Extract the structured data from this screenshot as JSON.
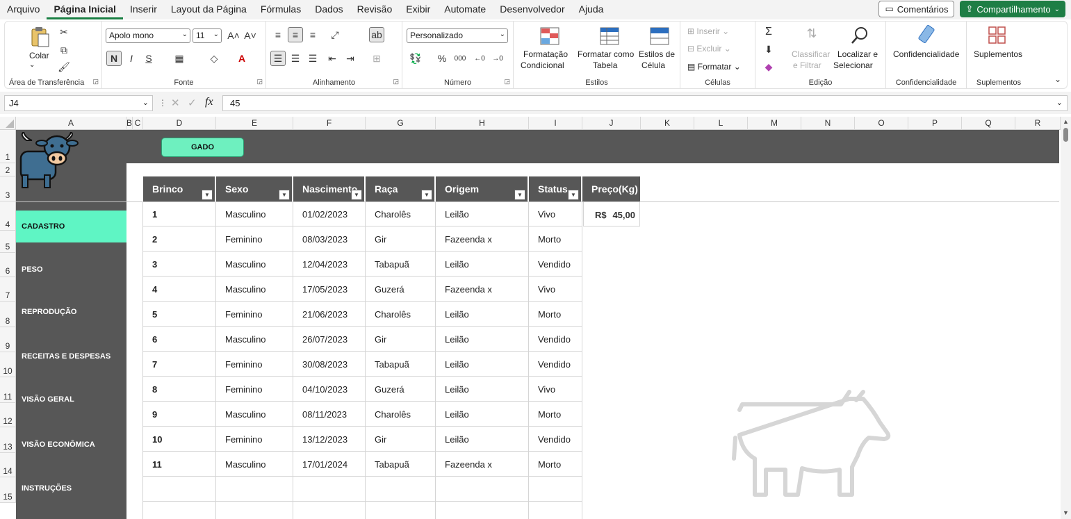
{
  "menu": {
    "tabs": [
      "Arquivo",
      "Página Inicial",
      "Inserir",
      "Layout da Página",
      "Fórmulas",
      "Dados",
      "Revisão",
      "Exibir",
      "Automate",
      "Desenvolvedor",
      "Ajuda"
    ],
    "comments_label": "Comentários",
    "share_label": "Compartilhamento"
  },
  "ribbon": {
    "clipboard": {
      "paste": "Colar",
      "label": "Área de Transferência"
    },
    "font": {
      "name": "Apolo mono",
      "size": "11",
      "bold": "N",
      "italic": "I",
      "underline": "S",
      "label": "Fonte"
    },
    "alignment": {
      "label": "Alinhamento"
    },
    "number": {
      "format": "Personalizado",
      "label": "Número"
    },
    "styles": {
      "cond_line1": "Formatação",
      "cond_line2": "Condicional",
      "table_line1": "Formatar como",
      "table_line2": "Tabela",
      "cell_line1": "Estilos de",
      "cell_line2": "Célula",
      "label": "Estilos"
    },
    "cells": {
      "insert": "Inserir",
      "delete": "Excluir",
      "format": "Formatar",
      "label": "Células"
    },
    "editing": {
      "sort_line1": "Classificar",
      "sort_line2": "e Filtrar",
      "find_line1": "Localizar e",
      "find_line2": "Selecionar",
      "label": "Edição"
    },
    "sensitivity": {
      "button": "Confidencialidade",
      "label": "Confidencialidade"
    },
    "addins": {
      "button": "Suplementos",
      "label": "Suplementos"
    }
  },
  "formula_bar": {
    "cell_ref": "J4",
    "value": "45"
  },
  "columns": [
    "A",
    "B",
    "C",
    "D",
    "E",
    "F",
    "G",
    "H",
    "I",
    "J",
    "K",
    "L",
    "M",
    "N",
    "O",
    "P",
    "Q",
    "R"
  ],
  "rows": [
    "1",
    "2",
    "3",
    "4",
    "5",
    "6",
    "7",
    "8",
    "9",
    "10",
    "11",
    "12",
    "13",
    "14",
    "15"
  ],
  "sheet": {
    "banner_button": "GADO",
    "nav": [
      "CADASTRO",
      "PESO",
      "REPRODUÇÃO",
      "RECEITAS E DESPESAS",
      "VISÃO GERAL",
      "VISÃO ECONÔMICA",
      "INSTRUÇÕES"
    ],
    "table": {
      "headers": [
        "Brinco",
        "Sexo",
        "Nascimento",
        "Raça",
        "Origem",
        "Status",
        "Preço(Kg)"
      ],
      "rows": [
        [
          "1",
          "Masculino",
          "01/02/2023",
          "Charolês",
          "Leilão",
          "Vivo"
        ],
        [
          "2",
          "Feminino",
          "08/03/2023",
          "Gir",
          "Fazeenda x",
          "Morto"
        ],
        [
          "3",
          "Masculino",
          "12/04/2023",
          "Tabapuã",
          "Leilão",
          "Vendido"
        ],
        [
          "4",
          "Masculino",
          "17/05/2023",
          "Guzerá",
          "Fazeenda x",
          "Vivo"
        ],
        [
          "5",
          "Feminino",
          "21/06/2023",
          "Charolês",
          "Leilão",
          "Morto"
        ],
        [
          "6",
          "Masculino",
          "26/07/2023",
          "Gir",
          "Leilão",
          "Vendido"
        ],
        [
          "7",
          "Feminino",
          "30/08/2023",
          "Tabapuã",
          "Leilão",
          "Vendido"
        ],
        [
          "8",
          "Feminino",
          "04/10/2023",
          "Guzerá",
          "Leilão",
          "Vivo"
        ],
        [
          "9",
          "Masculino",
          "08/11/2023",
          "Charolês",
          "Leilão",
          "Morto"
        ],
        [
          "10",
          "Feminino",
          "13/12/2023",
          "Gir",
          "Leilão",
          "Vendido"
        ],
        [
          "11",
          "Masculino",
          "17/01/2024",
          "Tabapuã",
          "Fazeenda x",
          "Morto"
        ]
      ],
      "price_currency": "R$",
      "price_value": "45,00"
    }
  }
}
